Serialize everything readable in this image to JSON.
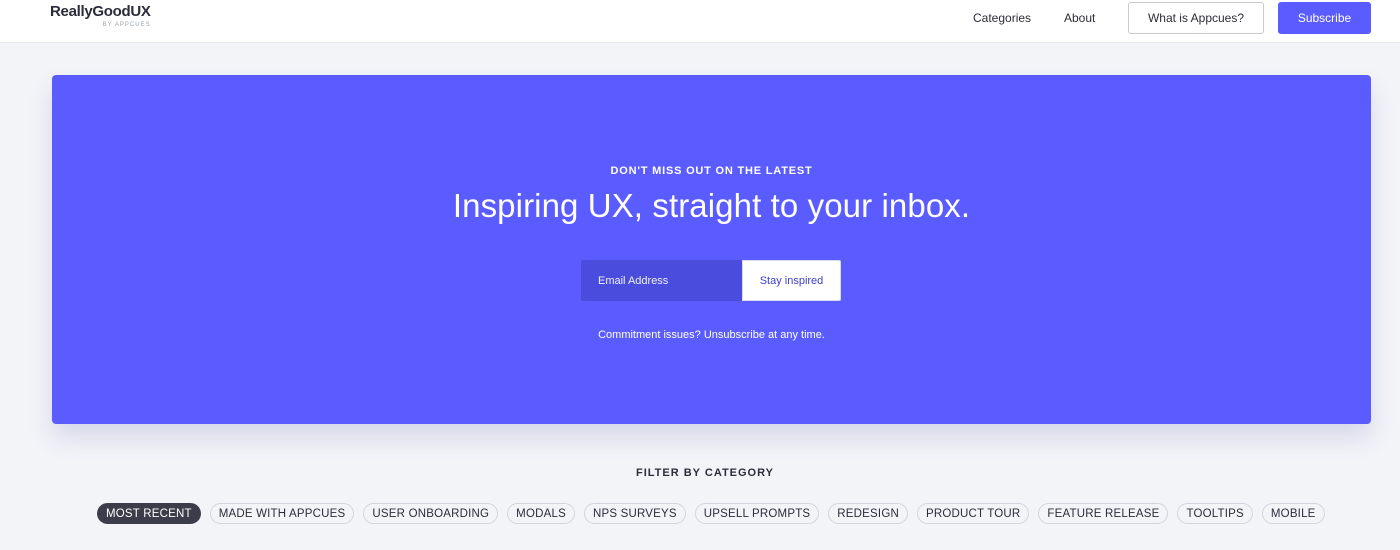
{
  "brand": {
    "name": "ReallyGoodUX",
    "sub": "BY APPCUES"
  },
  "nav": {
    "categories": "Categories",
    "about": "About",
    "what_is": "What is Appcues?",
    "subscribe": "Subscribe"
  },
  "hero": {
    "eyebrow": "DON'T MISS OUT ON THE LATEST",
    "headline": "Inspiring UX, straight to your inbox.",
    "email_placeholder": "Email Address",
    "cta": "Stay inspired",
    "note": "Commitment issues? Unsubscribe at any time."
  },
  "filters": {
    "title": "FILTER BY CATEGORY",
    "selected": "MOST RECENT",
    "items": [
      "MOST RECENT",
      "MADE WITH APPCUES",
      "USER ONBOARDING",
      "MODALS",
      "NPS SURVEYS",
      "UPSELL PROMPTS",
      "REDESIGN",
      "PRODUCT TOUR",
      "FEATURE RELEASE",
      "TOOLTIPS",
      "MOBILE"
    ]
  },
  "colors": {
    "accent": "#5a5cff",
    "input_bg": "#4a4cde",
    "active_chip": "#3c3d4a",
    "page_bg": "#f3f4f8"
  }
}
